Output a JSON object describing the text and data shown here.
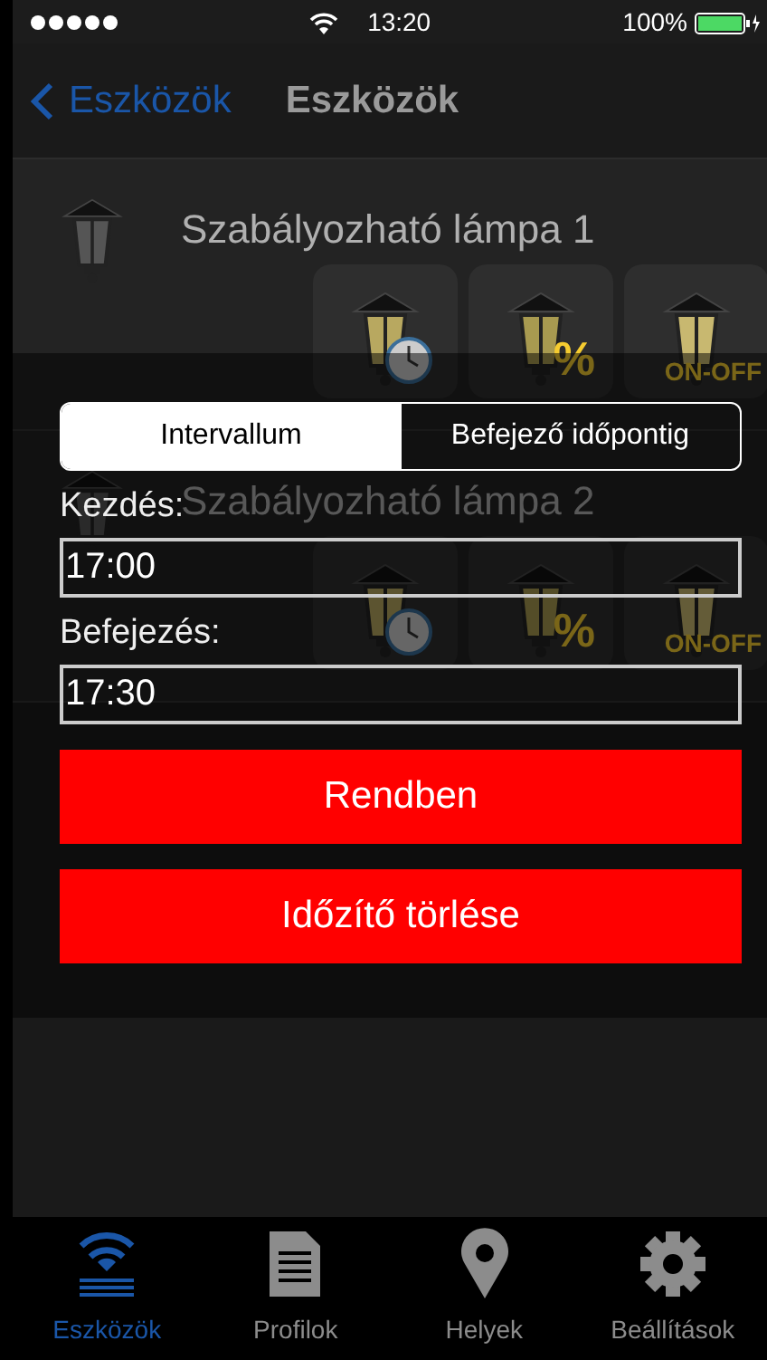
{
  "status_bar": {
    "time": "13:20",
    "battery": "100%"
  },
  "nav": {
    "back": "Eszközök",
    "title": "Eszközök"
  },
  "devices": [
    {
      "name": "Szabályozható lámpa 1",
      "tiles": [
        {
          "kind": "timer"
        },
        {
          "kind": "dim",
          "label": "%"
        },
        {
          "kind": "switch",
          "label": "ON-OFF"
        }
      ]
    },
    {
      "name": "Szabályozható lámpa 2",
      "tiles": [
        {
          "kind": "timer"
        },
        {
          "kind": "dim",
          "label": "%"
        },
        {
          "kind": "switch",
          "label": "ON-OFF"
        }
      ]
    }
  ],
  "dialog": {
    "segments": [
      {
        "label": "Intervallum",
        "selected": true
      },
      {
        "label": "Befejező időpontig",
        "selected": false
      }
    ],
    "fields": [
      {
        "label": "Kezdés:",
        "value": "17:00"
      },
      {
        "label": "Befejezés:",
        "value": "17:30"
      }
    ],
    "buttons": [
      {
        "label": "Rendben"
      },
      {
        "label": "Időzítő törlése"
      }
    ]
  },
  "tab_bar": [
    {
      "kind": "devices",
      "label": "Eszközök",
      "selected": true
    },
    {
      "kind": "profiles",
      "label": "Profilok",
      "selected": false
    },
    {
      "kind": "places",
      "label": "Helyek",
      "selected": false
    },
    {
      "kind": "settings",
      "label": "Beállítások",
      "selected": false
    }
  ]
}
